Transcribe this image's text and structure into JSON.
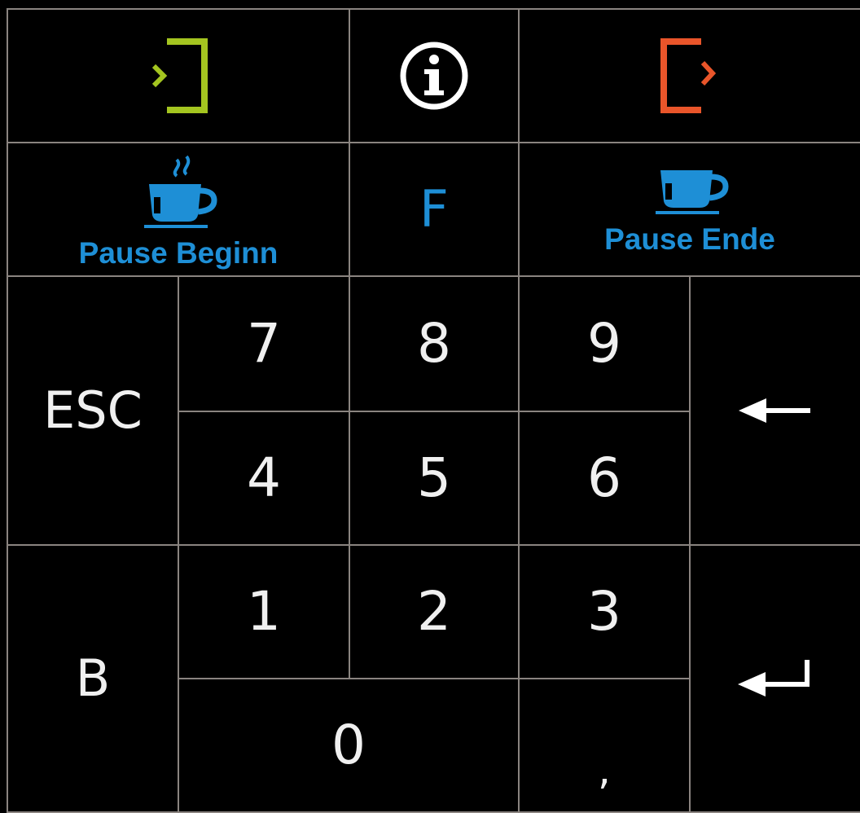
{
  "colors": {
    "background": "#000000",
    "grid": "#8a8480",
    "text": "#f0f0f0",
    "login_green": "#a4c520",
    "logout_orange": "#e9552a",
    "pause_blue": "#1e8fd6"
  },
  "top_row": {
    "login_icon": "login-icon",
    "info_icon": "info-icon",
    "logout_icon": "logout-icon"
  },
  "pause": {
    "begin_label": "Pause Beginn",
    "end_label": "Pause Ende",
    "f_label": "F"
  },
  "keys": {
    "esc": "ESC",
    "b": "B",
    "digits": {
      "d7": "7",
      "d8": "8",
      "d9": "9",
      "d4": "4",
      "d5": "5",
      "d6": "6",
      "d1": "1",
      "d2": "2",
      "d3": "3",
      "d0": "0"
    },
    "comma": ",",
    "backspace_icon": "backspace-arrow-icon",
    "enter_icon": "enter-icon"
  }
}
